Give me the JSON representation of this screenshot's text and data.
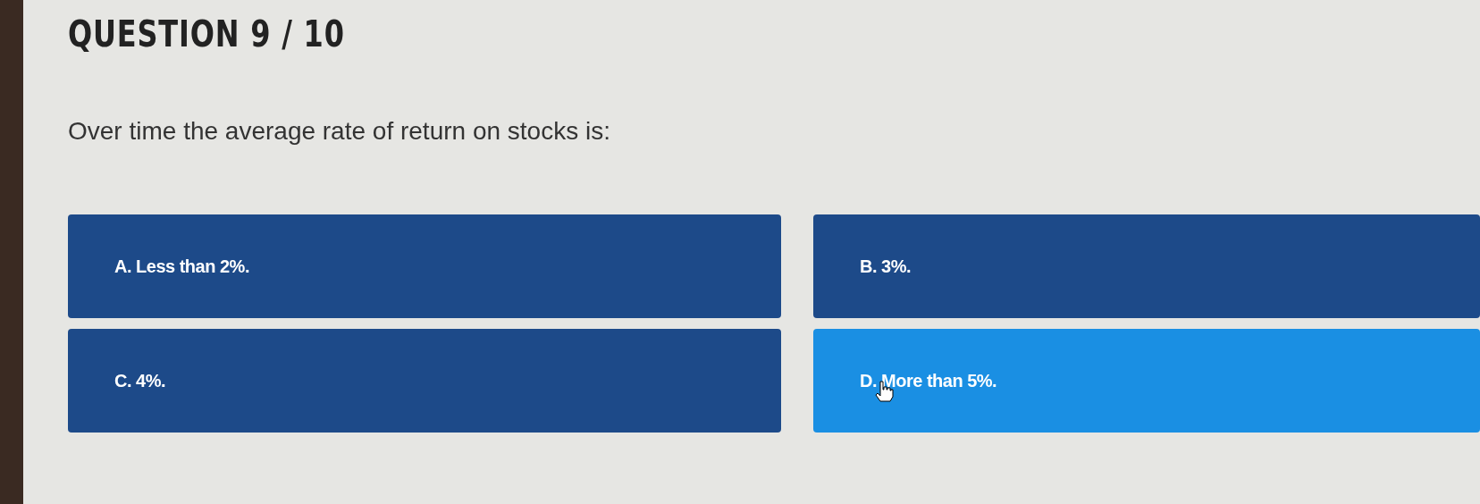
{
  "header": {
    "title": "QUESTION 9 / 10"
  },
  "question": {
    "text": "Over time the average rate of return on stocks is:"
  },
  "options": [
    {
      "label": "A. Less than 2%.",
      "selected": false
    },
    {
      "label": "B. 3%.",
      "selected": false
    },
    {
      "label": "C. 4%.",
      "selected": false
    },
    {
      "label": "D. More than 5%.",
      "selected": true
    }
  ]
}
